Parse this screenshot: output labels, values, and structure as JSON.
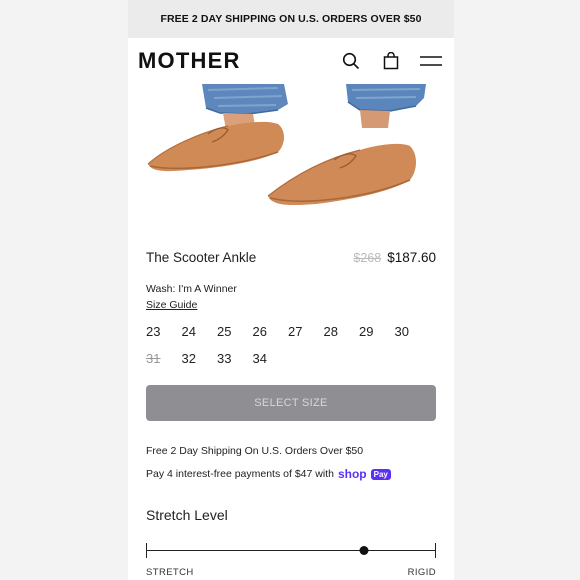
{
  "promo_bar": {
    "text": "FREE 2 DAY SHIPPING ON U.S. ORDERS OVER $50"
  },
  "header": {
    "logo": "MOTHER",
    "icons": [
      "search-icon",
      "shopping-bag-icon",
      "menu-icon"
    ]
  },
  "product": {
    "title": "The Scooter Ankle",
    "original_price": "$268",
    "sale_price": "$187.60",
    "wash": "Wash: I'm A Winner",
    "size_guide": "Size Guide",
    "sizes": [
      {
        "label": "23",
        "available": true
      },
      {
        "label": "24",
        "available": true
      },
      {
        "label": "25",
        "available": true
      },
      {
        "label": "26",
        "available": true
      },
      {
        "label": "27",
        "available": true
      },
      {
        "label": "28",
        "available": true
      },
      {
        "label": "29",
        "available": true
      },
      {
        "label": "30",
        "available": true
      },
      {
        "label": "31",
        "available": false
      },
      {
        "label": "32",
        "available": true
      },
      {
        "label": "33",
        "available": true
      },
      {
        "label": "34",
        "available": true
      }
    ],
    "select_size_label": "SELECT SIZE",
    "shipping_note": "Free 2 Day Shipping On U.S. Orders Over $50",
    "installments_text": "Pay 4 interest-free payments of $47 with",
    "shop_pay": {
      "word": "shop",
      "badge": "Pay",
      "color": "#5a31f4"
    }
  },
  "stretch": {
    "title": "Stretch Level",
    "left_label": "STRETCH",
    "right_label": "RIGID",
    "level": 0.75
  }
}
